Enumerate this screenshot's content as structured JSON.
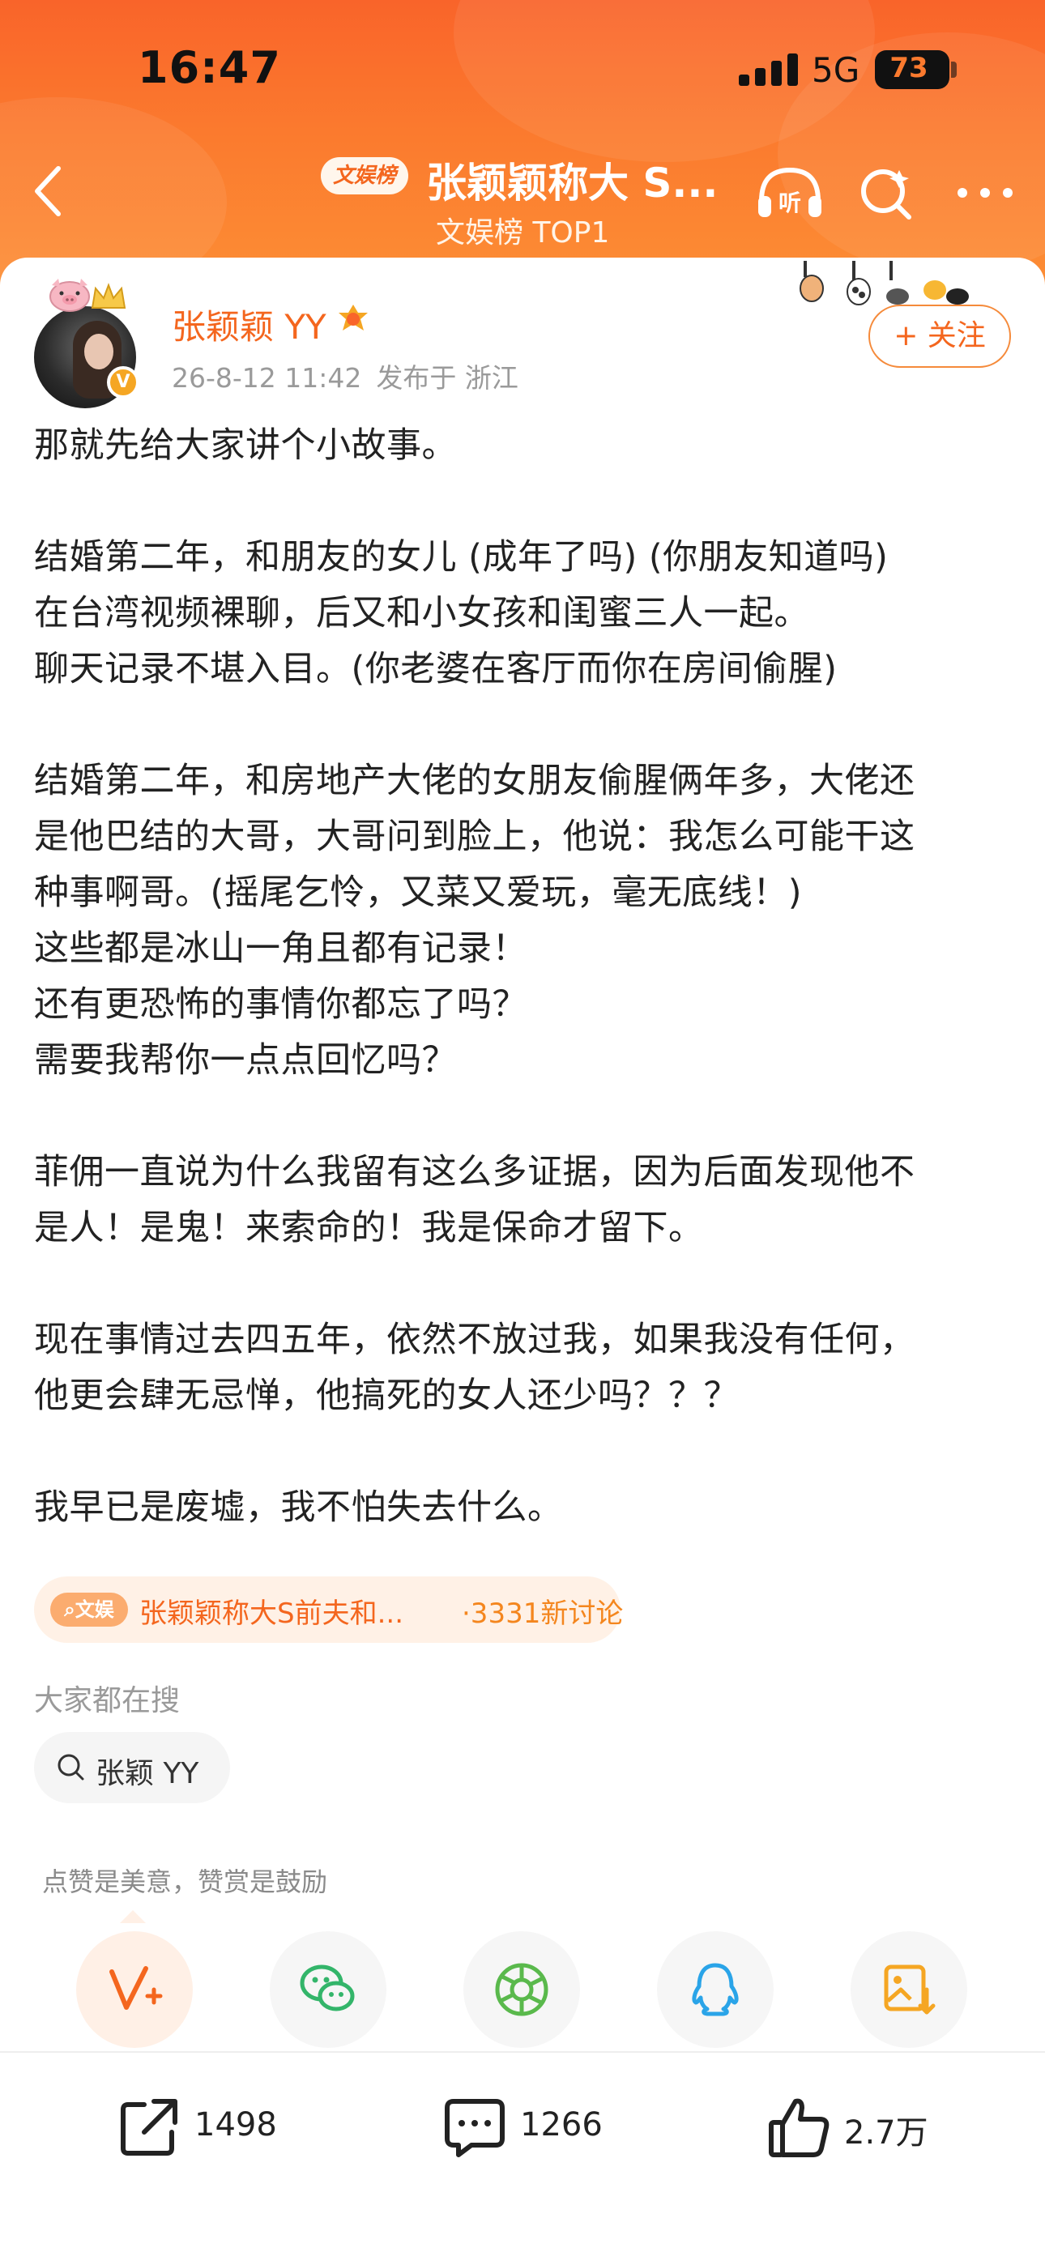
{
  "status_bar": {
    "time": "16:47",
    "network": "5G",
    "battery": "73"
  },
  "header": {
    "category_badge": "文娱榜",
    "title": "张颖颖称大 S...",
    "subtitle": "文娱榜 TOP1",
    "listen_icon_label": "听"
  },
  "post": {
    "author": {
      "name": "张颖颖 YY",
      "verified_mark": "V"
    },
    "date": "26-8-12 11:42",
    "location": "发布于 浙江",
    "follow_label": "+ 关注",
    "lines": [
      "那就先给大家讲个小故事。",
      "",
      "结婚第二年，和朋友的女儿 (成年了吗) (你朋友知道吗)",
      "在台湾视频裸聊，后又和小女孩和闺蜜三人一起。",
      "聊天记录不堪入目。(你老婆在客厅而你在房间偷腥)",
      "",
      "结婚第二年，和房地产大佬的女朋友偷腥俩年多，大佬还",
      "是他巴结的大哥，大哥问到脸上，他说：我怎么可能干这",
      "种事啊哥。(摇尾乞怜，又菜又爱玩，毫无底线！)",
      "这些都是冰山一角且都有记录！",
      "还有更恐怖的事情你都忘了吗？",
      "需要我帮你一点点回忆吗？",
      "",
      "菲佣一直说为什么我留有这么多证据，因为后面发现他不",
      "是人！是鬼！来索命的！我是保命才留下。",
      "",
      "现在事情过去四五年，依然不放过我，如果我没有任何，",
      "他更会肆无忌惮，他搞死的女人还少吗？？？",
      "",
      "我早已是废墟，我不怕失去什么。"
    ],
    "topic": {
      "tag": "文娱",
      "text": "张颖颖称大S前夫和...",
      "count": "·3331新讨论"
    }
  },
  "search": {
    "heading": "大家都在搜",
    "chip": "张颖 YY"
  },
  "reward_hint": "点赞是美意，赞赏是鼓励",
  "share_targets": [
    "weibo-tip-icon",
    "wechat-icon",
    "moments-icon",
    "qq-icon",
    "save-image-icon"
  ],
  "actions": {
    "repost_count": "1498",
    "comment_count": "1266",
    "like_count": "2.7万"
  },
  "colors": {
    "accent": "#f4661e",
    "header_top": "#f9642a",
    "header_bottom": "#fc8e35"
  }
}
